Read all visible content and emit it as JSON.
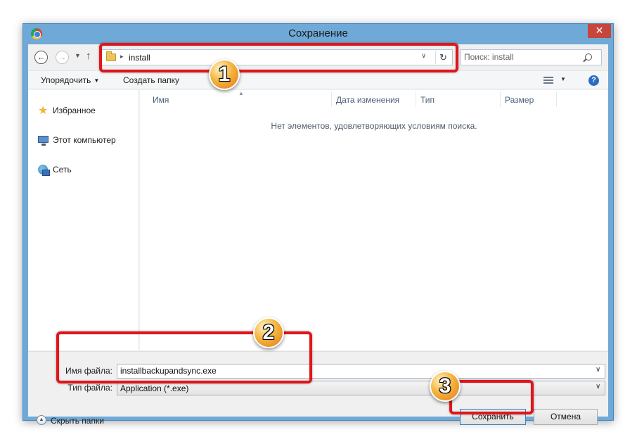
{
  "window": {
    "title": "Сохранение",
    "close_label": "✕"
  },
  "nav": {
    "back_glyph": "←",
    "forward_glyph": "→",
    "recent_glyph": "▼",
    "up_glyph": "↑",
    "address_path": "install",
    "breadcrumb_separator": "▸",
    "address_dropdown_glyph": "∨",
    "refresh_glyph": "↻",
    "search_placeholder": "Поиск: install"
  },
  "toolbar": {
    "organize_label": "Упорядочить",
    "new_folder_label": "Создать папку",
    "help_glyph": "?"
  },
  "sidebar": {
    "items": [
      {
        "label": "Избранное",
        "icon": "star-icon"
      },
      {
        "label": "Этот компьютер",
        "icon": "computer-icon"
      },
      {
        "label": "Сеть",
        "icon": "network-icon"
      }
    ]
  },
  "files": {
    "columns": [
      "Имя",
      "Дата изменения",
      "Тип",
      "Размер"
    ],
    "sort_glyph": "▲",
    "empty_message": "Нет элементов, удовлетворяющих условиям поиска."
  },
  "form": {
    "filename_label": "Имя файла:",
    "filename_value": "installbackupandsync.exe",
    "filetype_label": "Тип файла:",
    "filetype_value": "Application (*.exe)",
    "dropdown_glyph": "∨"
  },
  "footer": {
    "hide_folders_label": "Скрыть папки",
    "hide_folders_glyph": "▲",
    "save_label": "Сохранить",
    "cancel_label": "Отмена"
  },
  "annotations": {
    "color": "#e0161b",
    "badges": [
      "1",
      "2",
      "3"
    ]
  }
}
